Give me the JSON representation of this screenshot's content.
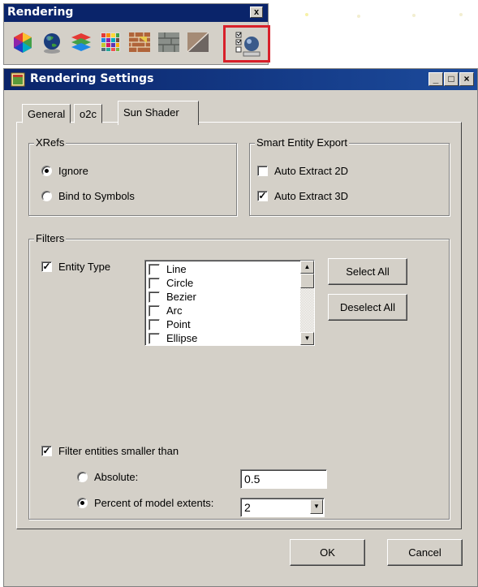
{
  "toolbar_window": {
    "title": "Rendering",
    "close_glyph": "x",
    "icons": [
      "color-wheel-icon",
      "globe-icon",
      "layers-icon",
      "material-grid-icon",
      "brick-texture-icon",
      "stone-texture-icon",
      "shading-icon",
      "render-settings-icon"
    ],
    "selected_icon": "render-settings-icon",
    "highlight_color": "#d8202a"
  },
  "dialog": {
    "title": "Rendering Settings",
    "window_buttons": {
      "minimize": "_",
      "maximize": "□",
      "close": "×"
    },
    "tabs": [
      {
        "label": "General",
        "active": false
      },
      {
        "label": "o2c",
        "active": false
      },
      {
        "label": "Sun Shader",
        "active": true
      }
    ],
    "xrefs": {
      "legend": "XRefs",
      "options": [
        {
          "label": "Ignore",
          "selected": true
        },
        {
          "label": "Bind to Symbols",
          "selected": false
        }
      ]
    },
    "smart_export": {
      "legend": "Smart Entity Export",
      "options": [
        {
          "label": "Auto Extract 2D",
          "checked": false
        },
        {
          "label": "Auto Extract 3D",
          "checked": true
        }
      ]
    },
    "filters": {
      "legend": "Filters",
      "entity_type_label": "Entity Type",
      "entity_type_checked": true,
      "entity_list": [
        {
          "label": "Line",
          "checked": false
        },
        {
          "label": "Circle",
          "checked": false
        },
        {
          "label": "Bezier",
          "checked": false
        },
        {
          "label": "Arc",
          "checked": false
        },
        {
          "label": "Point",
          "checked": false
        },
        {
          "label": "Ellipse",
          "checked": false
        }
      ],
      "select_all": "Select All",
      "deselect_all": "Deselect All",
      "filter_small_label": "Filter entities smaller than",
      "filter_small_checked": true,
      "absolute_label": "Absolute:",
      "absolute_selected": false,
      "absolute_value": "0.5",
      "percent_label": "Percent of model extents:",
      "percent_selected": true,
      "percent_value": "2"
    },
    "ok_label": "OK",
    "cancel_label": "Cancel"
  }
}
